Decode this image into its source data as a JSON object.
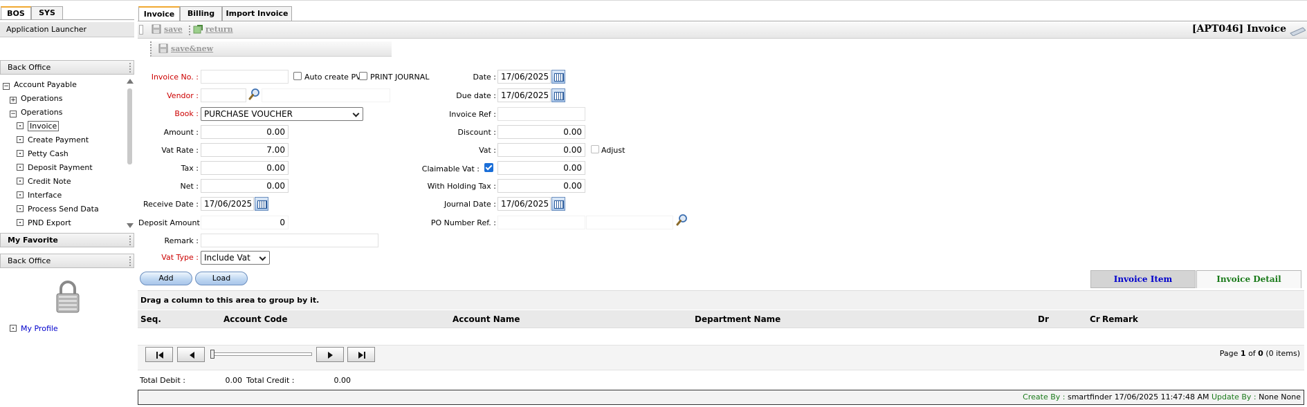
{
  "left_tabs": [
    "BOS",
    "SYS"
  ],
  "app_launcher": "Application Launcher",
  "section_back_office": "Back Office",
  "tree": {
    "root": "Account Payable",
    "items": [
      {
        "label": "Operations",
        "expander": "+"
      },
      {
        "label": "Operations",
        "expander": "-"
      },
      {
        "label": "Invoice",
        "selected": true
      },
      {
        "label": "Create Payment"
      },
      {
        "label": "Petty Cash"
      },
      {
        "label": "Deposit Payment"
      },
      {
        "label": "Credit Note"
      },
      {
        "label": "Interface"
      },
      {
        "label": "Process Send Data"
      },
      {
        "label": "PND Export"
      }
    ]
  },
  "section_favorite": "My Favorite",
  "section_back_office_2": "Back Office",
  "my_profile": "My Profile",
  "main_tabs": [
    "Invoice",
    "Billing",
    "Import Invoice"
  ],
  "toolbar": {
    "save": "save",
    "return": "return",
    "save_new": "save&new"
  },
  "screen_title": "[APT046] Invoice",
  "form": {
    "invoice_no_label": "Invoice No. :",
    "auto_create_pv": "Auto create PV",
    "print_journal": "PRINT JOURNAL",
    "vendor_label": "Vendor :",
    "book_label": "Book :",
    "book_value": "PURCHASE VOUCHER",
    "amount_label": "Amount :",
    "amount_value": "0.00",
    "vat_rate_label": "Vat Rate :",
    "vat_rate_value": "7.00",
    "tax_label": "Tax :",
    "tax_value": "0.00",
    "net_label": "Net :",
    "net_value": "0.00",
    "receive_date_label": "Receive Date :",
    "receive_date_value": "17/06/2025",
    "deposit_amount_label": "Deposit Amount :",
    "deposit_amount_value": "0",
    "remark_label": "Remark :",
    "vat_type_label": "Vat Type :",
    "vat_type_value": "Include Vat",
    "date_label": "Date :",
    "date_value": "17/06/2025",
    "due_date_label": "Due date :",
    "due_date_value": "17/06/2025",
    "invoice_ref_label": "Invoice Ref :",
    "discount_label": "Discount :",
    "discount_value": "0.00",
    "vat_label": "Vat :",
    "vat_value": "0.00",
    "adjust_label": "Adjust",
    "claimable_vat_label": "Claimable Vat :",
    "claimable_vat_amount": "0.00",
    "with_holding_tax_label": "With Holding Tax :",
    "with_holding_tax_value": "0.00",
    "journal_date_label": "Journal Date :",
    "journal_date_value": "17/06/2025",
    "po_number_ref_label": "PO Number Ref. :"
  },
  "buttons": {
    "add": "Add",
    "load": "Load"
  },
  "grid_tabs": [
    "Invoice Item",
    "Invoice Detail"
  ],
  "grid": {
    "group_hint": "Drag a column to this area to group by it.",
    "columns": [
      "Seq.",
      "Account Code",
      "Account Name",
      "Department Name",
      "Dr",
      "Cr",
      "Remark"
    ],
    "page_prefix": "Page",
    "page_current": "1",
    "page_of": "of",
    "page_total": "0",
    "items_text": "(0 items)"
  },
  "totals": {
    "debit_label": "Total Debit :",
    "debit_value": "0.00",
    "credit_label": "Total Credit :",
    "credit_value": "0.00"
  },
  "status": {
    "create_by_label": "Create By :",
    "create_by_user": "smartfinder",
    "create_time": "17/06/2025 11:47:48 AM",
    "update_by_label": "Update By :",
    "update_by_user": "None",
    "update_time": "None"
  },
  "colors": {
    "required_label": "#cc0000",
    "link_blue": "#0000cc",
    "detail_green": "#1a7a1a",
    "tab_accent": "#f0a830"
  }
}
